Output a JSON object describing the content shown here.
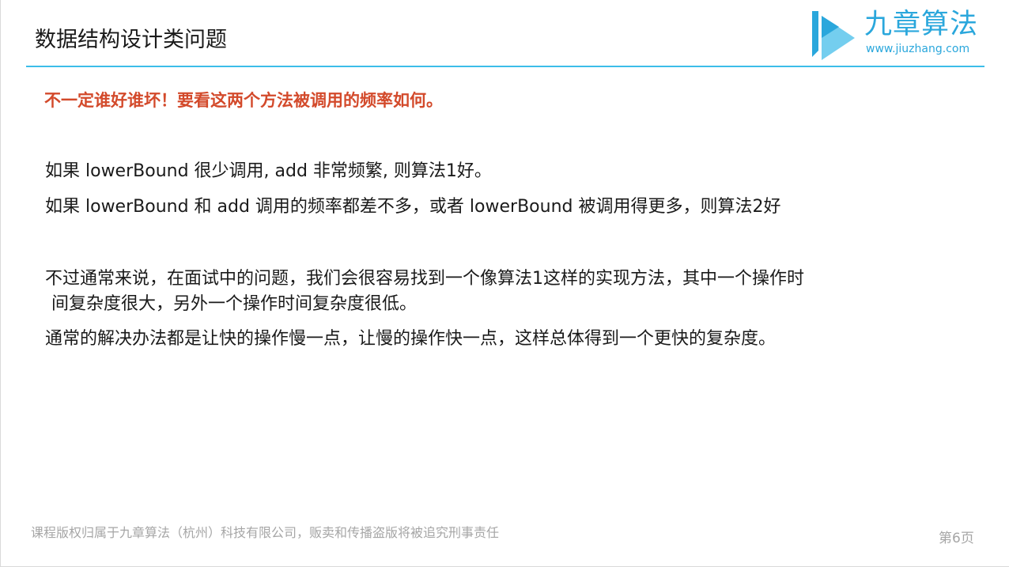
{
  "slide": {
    "title": "数据结构设计类问题",
    "highlight": "不一定谁好谁坏！要看这两个方法被调用的频率如何。",
    "paragraphs": [
      "如果 lowerBound 很少调用, add 非常频繁, 则算法1好。",
      "如果 lowerBound 和 add 调用的频率都差不多，或者 lowerBound 被调用得更多，则算法2好",
      "不过通常来说，在面试中的问题，我们会很容易找到一个像算法1这样的实现方法，其中一个操作时",
      "间复杂度很大，另外一个操作时间复杂度很低。",
      "通常的解决办法都是让快的操作慢一点，让慢的操作快一点，这样总体得到一个更快的复杂度。"
    ]
  },
  "logo": {
    "name": "九章算法",
    "url": "www.jiuzhang.com",
    "icon": "jiuzhang-logo-icon",
    "color": "#2aa7dc"
  },
  "footer": {
    "copyright": "课程版权归属于九章算法（杭州）科技有限公司，贩卖和传播盗版将被追究刑事责任",
    "page": "第6页"
  },
  "colors": {
    "accent_rule": "#3cbde9",
    "highlight": "#d34a2b",
    "footer": "#a6a6a6"
  }
}
